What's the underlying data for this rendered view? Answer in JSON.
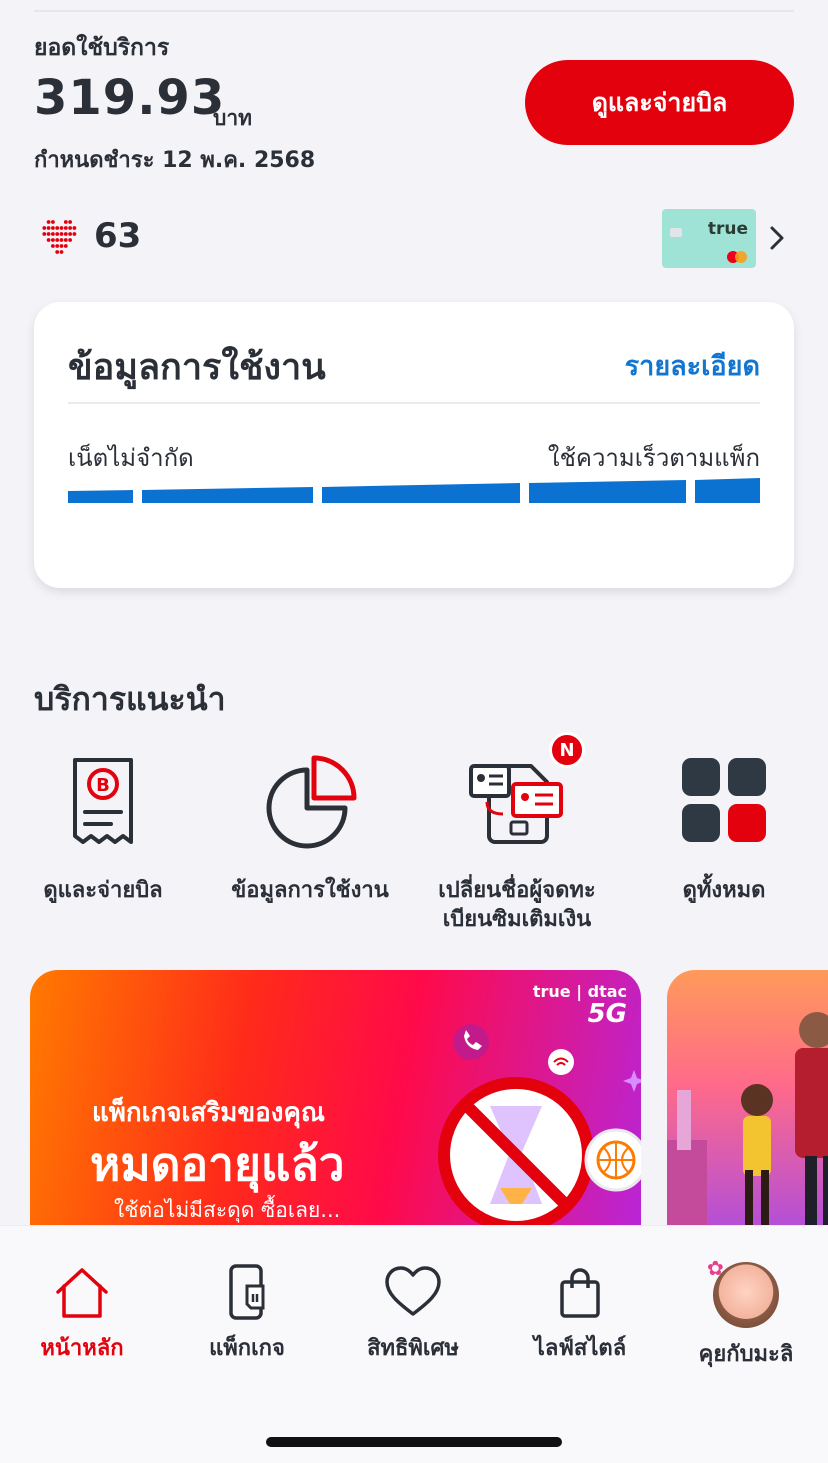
{
  "bill": {
    "label": "ยอดใช้บริการ",
    "amount": "319.93",
    "unit": "บาท",
    "due": "กำหนดชำระ 12 พ.ค. 2568",
    "pay_button": "ดูและจ่ายบิล"
  },
  "points": {
    "value": "63",
    "icon": "heart-points-icon"
  },
  "card": {
    "brand": "true",
    "icon": "mastercard-icon"
  },
  "usage": {
    "title": "ข้อมูลการใช้งาน",
    "detail_link": "รายละเอียด",
    "plan_label": "เน็ตไม่จำกัด",
    "speed_label": "ใช้ความเร็วตามแพ็ก",
    "bar_color": "#0c72d1"
  },
  "services": {
    "title": "บริการแนะนำ",
    "items": [
      {
        "label": "ดูและจ่ายบิล",
        "icon": "bill-receipt-icon"
      },
      {
        "label": "ข้อมูลการใช้งาน",
        "icon": "usage-pie-icon"
      },
      {
        "label": "เปลี่ยนชื่อผู้จดทะ",
        "label2": "เบียนซิมเติมเงิน",
        "icon": "transfer-sim-owner-icon",
        "badge": "N"
      },
      {
        "label": "ดูทั้งหมด",
        "icon": "grid-all-icon"
      }
    ]
  },
  "banner": {
    "logo_brand": "true | dtac",
    "logo_5g": "5G",
    "line1": "แพ็กเกจเสริมของคุณ",
    "line2": "หมดอายุแล้ว",
    "line3": "ใช้ต่อไม่มีสะดุด ซื้อเลย..."
  },
  "tabs": [
    {
      "label": "หน้าหลัก",
      "icon": "home-icon",
      "active": true
    },
    {
      "label": "แพ็กเกจ",
      "icon": "phone-sim-icon"
    },
    {
      "label": "สิทธิพิเศษ",
      "icon": "heart-icon"
    },
    {
      "label": "ไลฟ์สไตล์",
      "icon": "shopping-bag-icon"
    },
    {
      "label": "คุยกับมะลิ",
      "icon": "mali-avatar-icon"
    }
  ],
  "colors": {
    "brand_red": "#e2010d",
    "link_blue": "#1276d0",
    "text": "#2b2f38"
  }
}
